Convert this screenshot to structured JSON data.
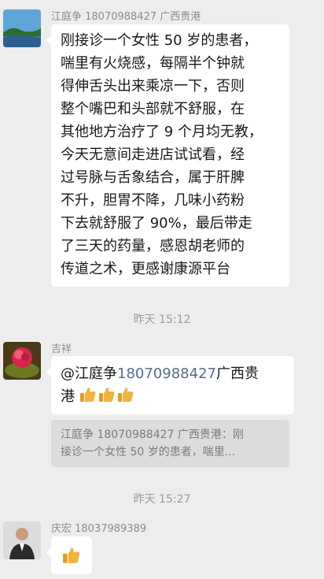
{
  "messages": [
    {
      "sender": "江庭争 18070988427 广西贵港",
      "lines": [
        "刚接诊一个女性 50 岁的患者，",
        "喘里有火烧感，每隔半个钟就",
        "得伸舌头出来乘凉一下，否则",
        "整个嘴巴和头部就不舒服，在",
        "其他地方治疗了 9 个月均无教，",
        "今天无意间走进店试试看，经",
        "过号脉与舌象结合，属于肝脾",
        "不升，胆胃不降，几味小药粉",
        "下去就舒服了 90%，最后带走",
        "了三天的药量，感恩胡老师的",
        "传道之术，更感谢康源平台"
      ]
    },
    {
      "sender": "吉祥",
      "mention_prefix": "@江庭争",
      "mention_phone": "18070988427",
      "mention_suffix": "广西贵",
      "line2": "港",
      "quote": {
        "line1": "江庭争 18070988427 广西贵港：刚",
        "line2": "接诊一个女性 50 岁的患者，喘里..."
      }
    },
    {
      "sender": "庆宏 18037989389"
    }
  ],
  "timestamps": [
    "昨天 15:12",
    "昨天 15:27"
  ],
  "icons": {
    "thumbs_up": "thumbs-up-icon"
  },
  "colors": {
    "background": "#ededed",
    "bubble": "#ffffff",
    "link": "#576b95",
    "thumb": "#f2b33d"
  }
}
